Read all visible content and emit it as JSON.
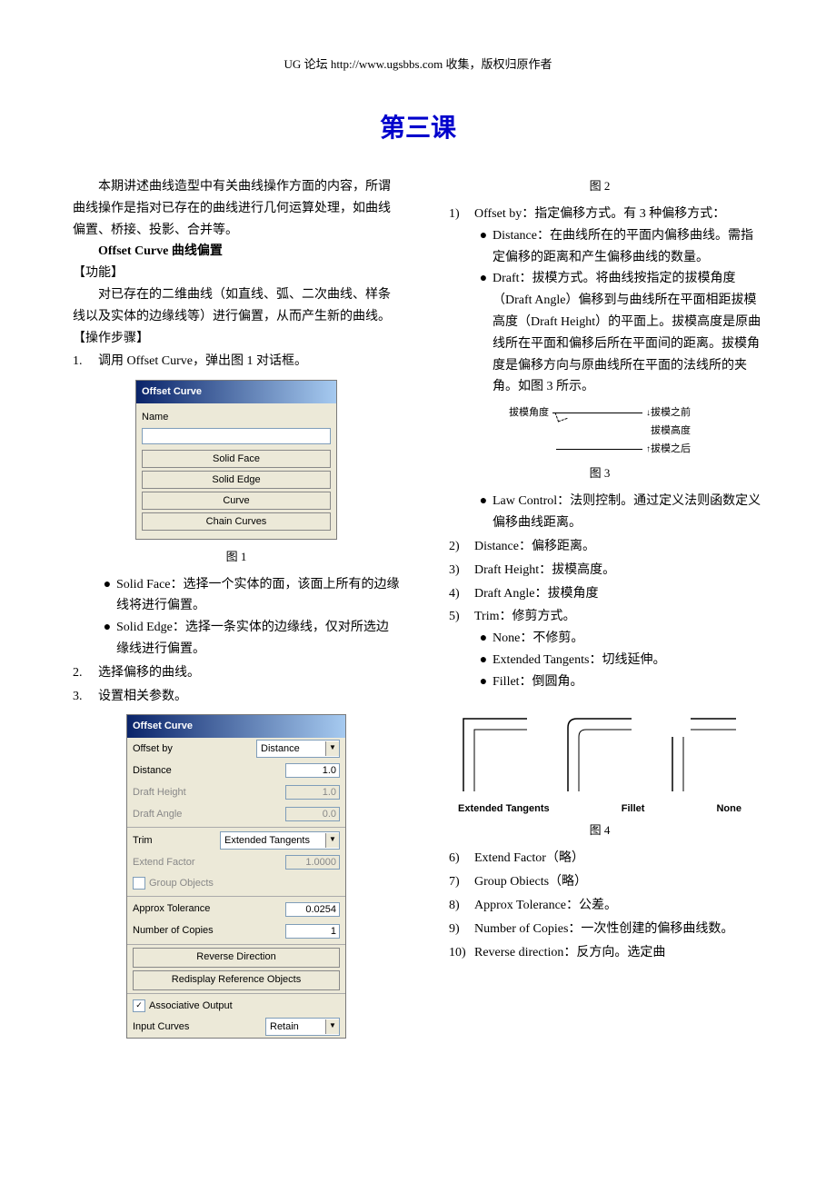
{
  "header": "UG 论坛 http://www.ugsbbs.com 收集，版权归原作者",
  "title": "第三课",
  "left": {
    "intro": "本期讲述曲线造型中有关曲线操作方面的内容，所谓曲线操作是指对已存在的曲线进行几何运算处理，如曲线偏置、桥接、投影、合并等。",
    "section_title": "Offset Curve 曲线偏置",
    "func_label": "【功能】",
    "func_body": "对已存在的二维曲线（如直线、弧、二次曲线、样条线以及实体的边缘线等）进行偏置，从而产生新的曲线。",
    "steps_label": "【操作步骤】",
    "step1_num": "1.",
    "step1": "调用 Offset Curve，弹出图 1 对话框。",
    "caption1": "图 1",
    "bullet_sf": "Solid Face：选择一个实体的面，该面上所有的边缘线将进行偏置。",
    "bullet_se": "Solid Edge：选择一条实体的边缘线，仅对所选边缘线进行偏置。",
    "step2_num": "2.",
    "step2": "选择偏移的曲线。",
    "step3_num": "3.",
    "step3": "设置相关参数。",
    "caption2": "图 2"
  },
  "dialog1": {
    "title": "Offset Curve",
    "name_label": "Name",
    "btn1": "Solid Face",
    "btn2": "Solid Edge",
    "btn3": "Curve",
    "btn4": "Chain Curves"
  },
  "dialog2": {
    "title": "Offset Curve",
    "offset_by": "Offset by",
    "offset_by_val": "Distance",
    "distance": "Distance",
    "distance_val": "1.0",
    "draft_h": "Draft Height",
    "draft_h_val": "1.0",
    "draft_a": "Draft Angle",
    "draft_a_val": "0.0",
    "trim": "Trim",
    "trim_val": "Extended Tangents",
    "extend": "Extend Factor",
    "extend_val": "1.0000",
    "group": "Group Objects",
    "approx": "Approx Tolerance",
    "approx_val": "0.0254",
    "copies": "Number of Copies",
    "copies_val": "1",
    "reverse": "Reverse Direction",
    "redisplay": "Redisplay Reference Objects",
    "assoc_check": "✓",
    "assoc": "Associative Output",
    "input_curves": "Input Curves",
    "input_curves_val": "Retain"
  },
  "right": {
    "i1_num": "1)",
    "i1": "Offset by：指定偏移方式。有 3 种偏移方式：",
    "b_distance": "Distance：在曲线所在的平面内偏移曲线。需指定偏移的距离和产生偏移曲线的数量。",
    "b_draft": "Draft：拔模方式。将曲线按指定的拔模角度（Draft   Angle）偏移到与曲线所在平面相距拔模高度（Draft   Height）的平面上。拔模高度是原曲线所在平面和偏移后所在平面间的距离。拔模角度是偏移方向与原曲线所在平面的法线所的夹角。如图 3 所示。",
    "caption3": "图 3",
    "b_law": "Law Control：法则控制。通过定义法则函数定义偏移曲线距离。",
    "i2_num": "2)",
    "i2": "Distance：偏移距离。",
    "i3_num": "3)",
    "i3": "Draft Height：拔模高度。",
    "i4_num": "4)",
    "i4": "Draft Angle：拔模角度",
    "i5_num": "5)",
    "i5": "Trim：修剪方式。",
    "b_none": "None：不修剪。",
    "b_ext": "Extended Tangents：切线延伸。",
    "b_fillet": "Fillet：倒圆角。",
    "caption4": "图 4",
    "i6_num": "6)",
    "i6": "Extend Factor（略）",
    "i7_num": "7)",
    "i7": "Group Obiects（略）",
    "i8_num": "8)",
    "i8": "Approx Tolerance：公差。",
    "i9_num": "9)",
    "i9": "Number of Copies：一次性创建的偏移曲线数。",
    "i10_num": "10)",
    "i10": "Reverse direction：反方向。选定曲"
  },
  "fig3": {
    "l1": "拔模角度",
    "l2": "拔模之前",
    "l3": "拔模高度",
    "l4": "拔模之后"
  },
  "fig4": {
    "l1": "Extended Tangents",
    "l2": "Fillet",
    "l3": "None"
  }
}
